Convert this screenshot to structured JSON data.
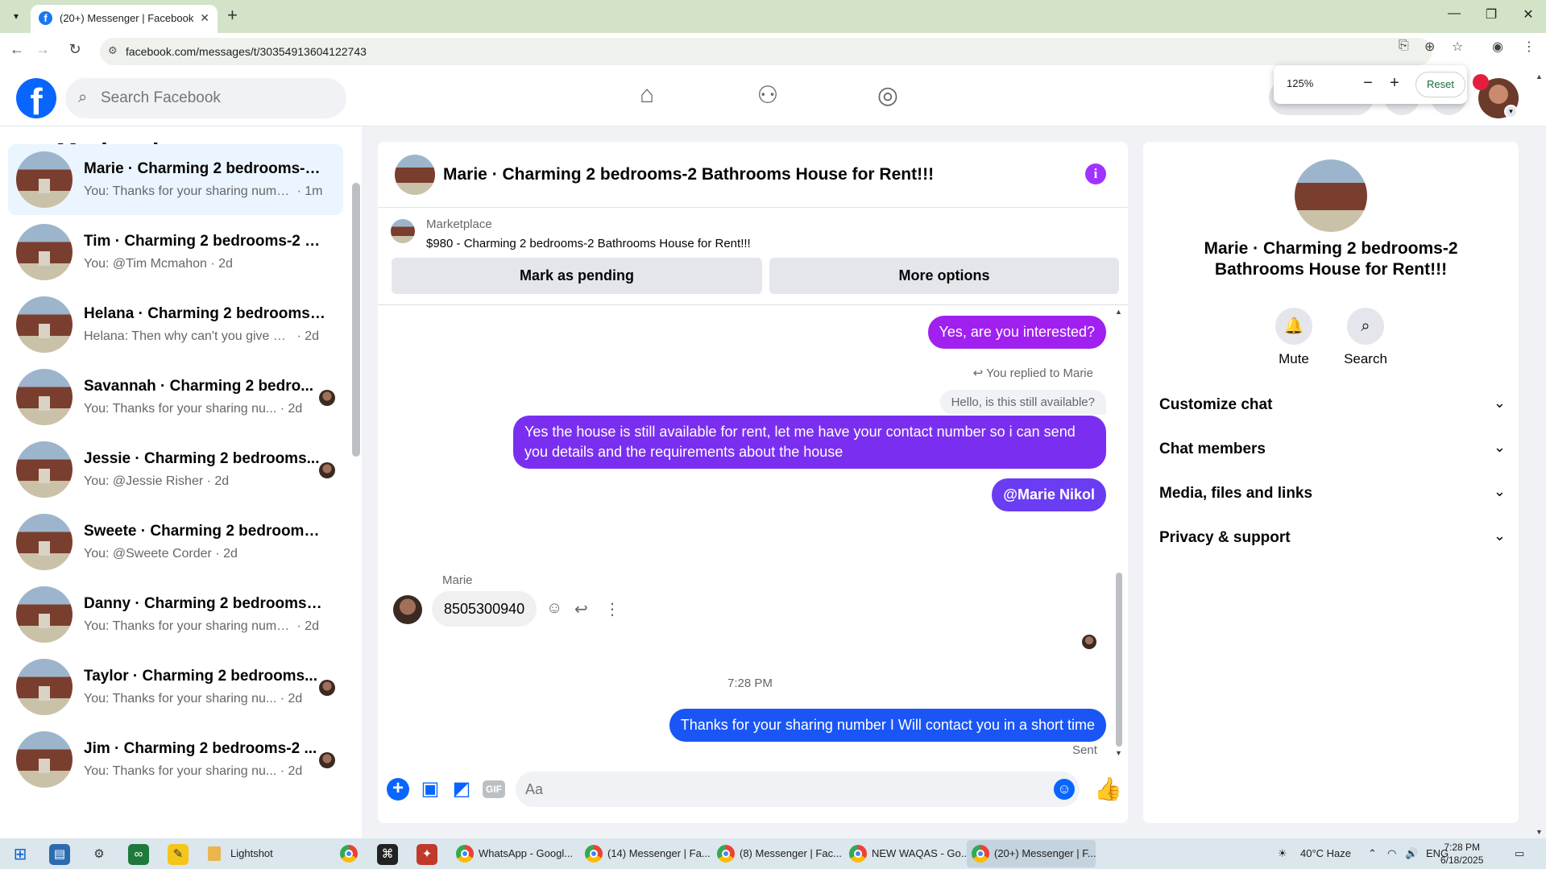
{
  "browser": {
    "tab_title": "(20+) Messenger | Facebook",
    "url": "facebook.com/messages/t/30354913604122743",
    "zoom": {
      "level": "125%",
      "reset_label": "Reset"
    }
  },
  "header": {
    "search_placeholder": "Search Facebook"
  },
  "sidebar": {
    "title": "Marketplace",
    "conversations": [
      {
        "name": "Marie · Charming 2 bedrooms-2 ...",
        "snippet": "You: Thanks for your sharing numb...",
        "time": "· 1m",
        "active": true,
        "seen": false
      },
      {
        "name": "Tim · Charming 2 bedrooms-2 B...",
        "snippet": "You: @Tim Mcmahon",
        "time": "· 2d",
        "active": false,
        "seen": false
      },
      {
        "name": "Helana · Charming 2 bedrooms-...",
        "snippet": "Helana: Then why can't you give me...",
        "time": "· 2d",
        "active": false,
        "seen": false
      },
      {
        "name": "Savannah · Charming 2 bedro...",
        "snippet": "You: Thanks for your sharing nu...",
        "time": "· 2d",
        "active": false,
        "seen": true
      },
      {
        "name": "Jessie · Charming 2 bedrooms...",
        "snippet": "You: @Jessie Risher",
        "time": "· 2d",
        "active": false,
        "seen": true
      },
      {
        "name": "Sweete · Charming 2 bedrooms-...",
        "snippet": "You: @Sweete Corder",
        "time": "· 2d",
        "active": false,
        "seen": false
      },
      {
        "name": "Danny · Charming 2 bedrooms-2...",
        "snippet": "You: Thanks for your sharing numb...",
        "time": "· 2d",
        "active": false,
        "seen": false
      },
      {
        "name": "Taylor · Charming 2 bedrooms...",
        "snippet": "You: Thanks for your sharing nu...",
        "time": "· 2d",
        "active": false,
        "seen": true
      },
      {
        "name": "Jim · Charming 2 bedrooms-2 ...",
        "snippet": "You: Thanks for your sharing nu...",
        "time": "· 2d",
        "active": false,
        "seen": true
      }
    ]
  },
  "chat": {
    "title": "Marie · Charming 2 bedrooms-2 Bathrooms House for Rent!!!",
    "marketplace_label": "Marketplace",
    "listing": "$980 - Charming 2 bedrooms-2 Bathrooms House for Rent!!!",
    "mark_pending_label": "Mark as pending",
    "more_options_label": "More options",
    "messages": {
      "out_1": "Yes, are you interested?",
      "reply_note": "You replied to Marie",
      "reply_quote": "Hello, is this still available?",
      "out_2": "Yes the house is still available for rent, let me have your contact number so i can send you details and the requirements about the house",
      "out_3": "@Marie Nikol",
      "in_sender": "Marie",
      "in_1": "8505300940",
      "timestamp": "7:28 PM",
      "out_4": "Thanks for your sharing number I Will contact you in  a short time",
      "sent_label": "Sent"
    },
    "composer_placeholder": "Aa",
    "gif_label": "GIF"
  },
  "details": {
    "title": "Marie · Charming 2 bedrooms-2 Bathrooms House for Rent!!!",
    "mute_label": "Mute",
    "search_label": "Search",
    "sections": [
      "Customize chat",
      "Chat members",
      "Media, files and links",
      "Privacy & support"
    ]
  },
  "taskbar": {
    "lightshot": "Lightshot",
    "items": [
      "WhatsApp - Googl...",
      "(14) Messenger | Fa...",
      "(8) Messenger | Fac...",
      "NEW WAQAS - Go...",
      "(20+) Messenger | F..."
    ],
    "weather": "40°C  Haze",
    "lang": "ENG",
    "time": "7:28 PM",
    "date": "6/18/2025"
  },
  "colors": {
    "fb_blue": "#0866ff",
    "bubble_purple": "#a020f0",
    "bubble_violet": "#7a2ff0",
    "bubble_blue": "#1a55f5"
  }
}
